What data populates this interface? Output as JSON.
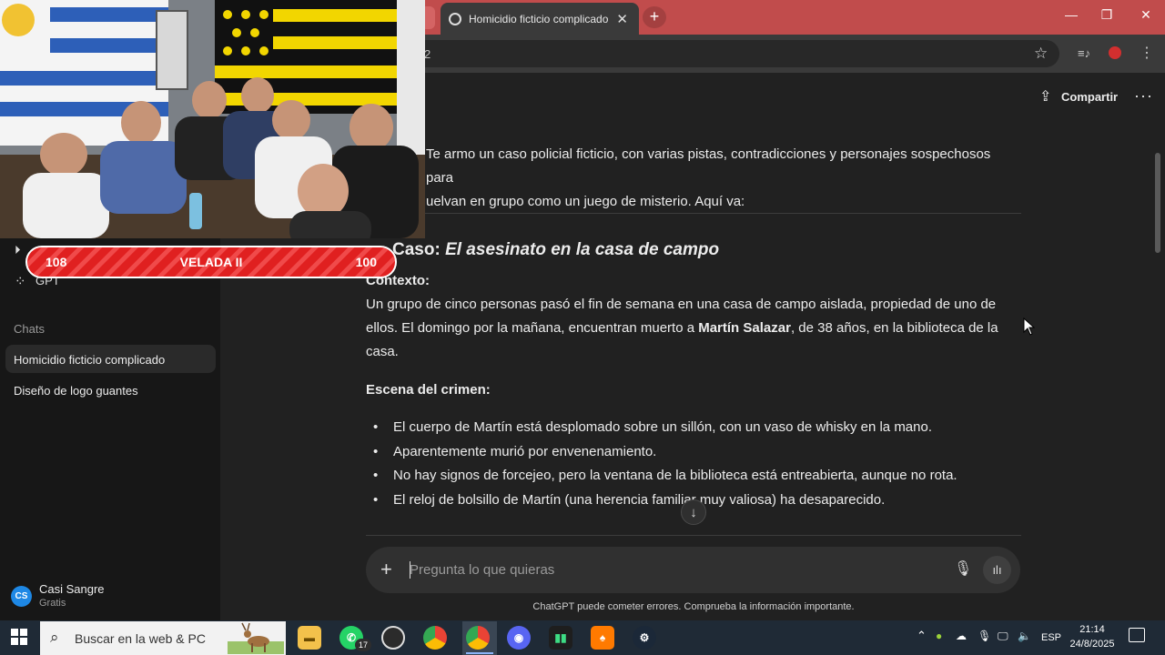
{
  "browser": {
    "tab_title": "Homicidio ficticio complicado",
    "tab_close": "✕",
    "new_tab": "+",
    "window_controls": {
      "minimize": "—",
      "maximize": "❐",
      "close": "✕"
    },
    "address_partial": "2"
  },
  "sidebar": {
    "gpt_label": "GPT",
    "chats_header": "Chats",
    "chats": [
      {
        "label": "Homicidio ficticio complicado",
        "active": true
      },
      {
        "label": "Diseño de logo guantes",
        "active": false
      }
    ],
    "user": {
      "initials": "CS",
      "name": "Casi Sangre",
      "plan": "Gratis"
    }
  },
  "header": {
    "share_label": "Compartir",
    "more": "···"
  },
  "content": {
    "intro_line1": "Te armo un caso policial ficticio, con varias pistas, contradicciones y personajes sospechosos para",
    "intro_line2": "uelvan en grupo como un juego de misterio. Aquí va:",
    "case_title_prefix": "Caso: ",
    "case_title_italic": "El asesinato en la casa de campo",
    "context_heading": "Contexto:",
    "context_before": "Un grupo de cinco personas pasó el fin de semana en una casa de campo aislada, propiedad de uno de ellos. El domingo por la mañana, encuentran muerto a ",
    "context_bold": "Martín Salazar",
    "context_after": ", de 38 años, en la biblioteca de la casa.",
    "scene_heading": "Escena del crimen:",
    "bullets": [
      "El cuerpo de Martín está desplomado sobre un sillón, con un vaso de whisky en la mano.",
      "Aparentemente murió por envenenamiento.",
      "No hay signos de forcejeo, pero la ventana de la biblioteca está entreabierta, aunque no rota.",
      "El reloj de bolsillo de Martín (una herencia familiar muy valiosa) ha desaparecido."
    ]
  },
  "composer": {
    "placeholder": "Pregunta lo que quieras",
    "disclaimer": "ChatGPT puede cometer errores. Comprueba la información importante."
  },
  "overlay": {
    "scoreboard": {
      "left_score": "108",
      "title": "VELADA II",
      "right_score": "100"
    }
  },
  "taskbar": {
    "search_label": "Buscar en la web & PC",
    "whatsapp_badge": "17",
    "language": "ESP",
    "time": "21:14",
    "date": "24/8/2025"
  },
  "colors": {
    "tabbar": "#c14c4c",
    "sidebar": "#171717",
    "main_bg": "#212121",
    "scoreboard_red": "#e02020",
    "avatar": "#1e88e5"
  }
}
